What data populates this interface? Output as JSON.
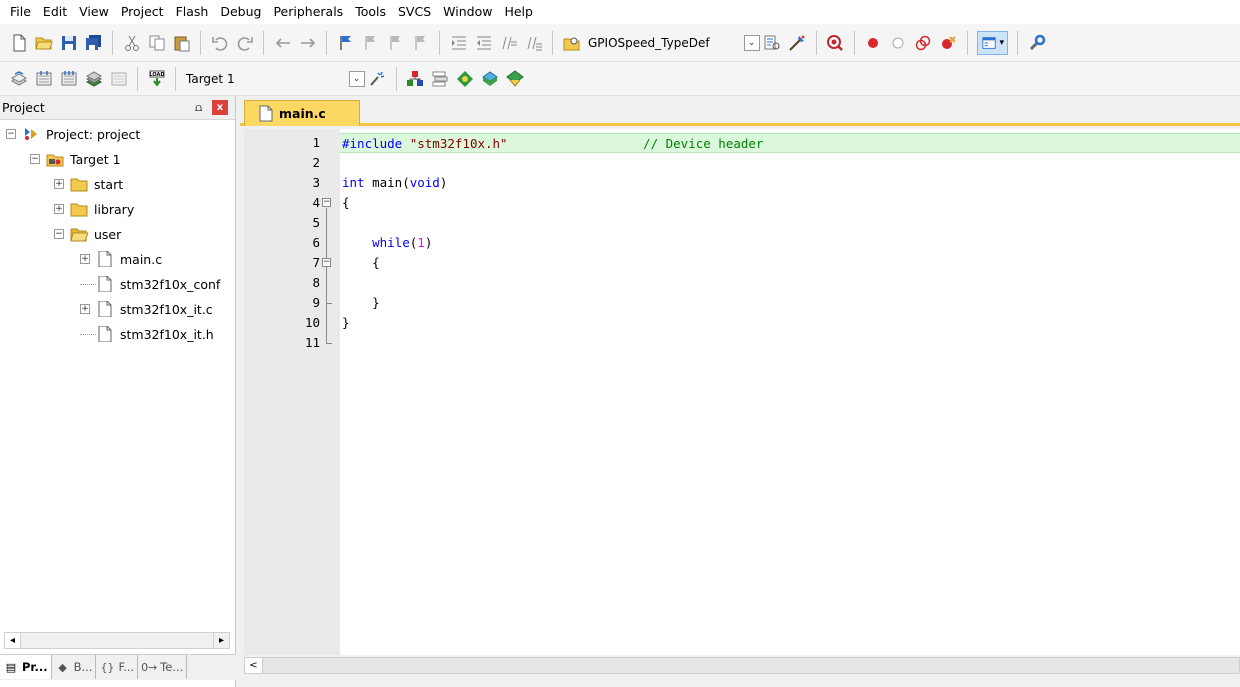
{
  "menu": [
    "File",
    "Edit",
    "View",
    "Project",
    "Flash",
    "Debug",
    "Peripherals",
    "Tools",
    "SVCS",
    "Window",
    "Help"
  ],
  "toolbar": {
    "find_combo_value": "GPIOSpeed_TypeDef",
    "target_combo_value": "Target 1"
  },
  "project_panel": {
    "title": "Project",
    "pin_glyph": "⩍",
    "close_glyph": "x",
    "tree": [
      {
        "label": "Project: project",
        "icon": "project-icon",
        "level": 0,
        "expander": "−"
      },
      {
        "label": "Target 1",
        "icon": "target-icon",
        "level": 1,
        "expander": "−"
      },
      {
        "label": "start",
        "icon": "folder-icon",
        "level": 2,
        "expander": "+"
      },
      {
        "label": "library",
        "icon": "folder-icon",
        "level": 2,
        "expander": "+"
      },
      {
        "label": "user",
        "icon": "folder-open-icon",
        "level": 2,
        "expander": "−"
      },
      {
        "label": "main.c",
        "icon": "file-icon",
        "level": 3,
        "expander": "+"
      },
      {
        "label": "stm32f10x_conf",
        "icon": "file-icon",
        "level": 3,
        "expander": ""
      },
      {
        "label": "stm32f10x_it.c",
        "icon": "file-icon",
        "level": 3,
        "expander": "+"
      },
      {
        "label": "stm32f10x_it.h",
        "icon": "file-icon",
        "level": 3,
        "expander": ""
      }
    ],
    "bottom_tabs": [
      {
        "label": "Pr...",
        "icon": "project-tab-icon",
        "glyph": "▤",
        "active": true
      },
      {
        "label": "B...",
        "icon": "books-tab-icon",
        "glyph": "◆",
        "active": false
      },
      {
        "label": "F...",
        "icon": "functions-tab-icon",
        "glyph": "{}",
        "active": false
      },
      {
        "label": "Te...",
        "icon": "templates-tab-icon",
        "glyph": "0→",
        "active": false
      }
    ],
    "scroll_left": "◂",
    "scroll_right": "▸"
  },
  "editor": {
    "tab_label": "main.c",
    "scroll_left": "<",
    "lines": [
      {
        "n": "1",
        "parts": [
          [
            "pp",
            "#include "
          ],
          [
            "str",
            "\"stm32f10x.h\""
          ],
          [
            "plain",
            "                  "
          ],
          [
            "cm",
            "// Device header"
          ]
        ]
      },
      {
        "n": "2",
        "parts": []
      },
      {
        "n": "3",
        "parts": [
          [
            "kw",
            "int"
          ],
          [
            "plain",
            " main("
          ],
          [
            "kw",
            "void"
          ],
          [
            "plain",
            ")"
          ]
        ]
      },
      {
        "n": "4",
        "parts": [
          [
            "plain",
            "{"
          ]
        ]
      },
      {
        "n": "5",
        "parts": []
      },
      {
        "n": "6",
        "parts": [
          [
            "plain",
            "    "
          ],
          [
            "kw",
            "while"
          ],
          [
            "plain",
            "("
          ],
          [
            "num",
            "1"
          ],
          [
            "plain",
            ")"
          ]
        ]
      },
      {
        "n": "7",
        "parts": [
          [
            "plain",
            "    {"
          ]
        ]
      },
      {
        "n": "8",
        "parts": []
      },
      {
        "n": "9",
        "parts": [
          [
            "plain",
            "    }"
          ]
        ]
      },
      {
        "n": "10",
        "parts": [
          [
            "plain",
            "}"
          ]
        ]
      },
      {
        "n": "11",
        "parts": []
      }
    ],
    "highlight_line": 1,
    "colors": {
      "keyword": "#0000ff",
      "string": "#800000",
      "comment": "#008000",
      "number": "#ff00ff",
      "current_line": "#dcf8dc",
      "tab_active": "#fcd862"
    }
  }
}
